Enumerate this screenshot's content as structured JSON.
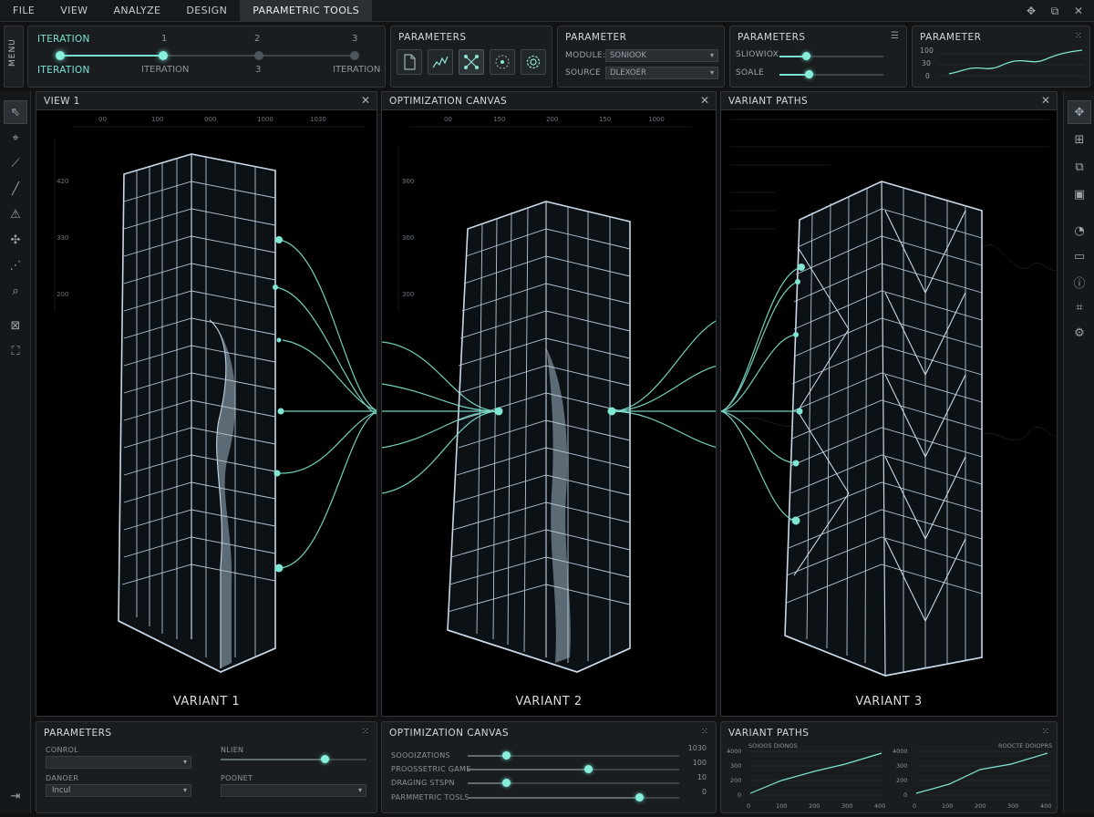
{
  "menu": {
    "items": [
      "FILE",
      "VIEW",
      "ANALYZE",
      "DESIGN",
      "PARAMETRIC TOOLS"
    ],
    "active": "PARAMETRIC TOOLS"
  },
  "side_tab": {
    "label": "MENU"
  },
  "iteration_panel": {
    "top_label": "ITERATION",
    "bottom_left_label": "ITERATION",
    "steps_top": [
      "1",
      "2",
      "3"
    ],
    "steps_bottom": [
      "ITERATION",
      "3",
      "ITERATION"
    ],
    "progress": 0.35
  },
  "tools_panel": {
    "title": "PARAMETERS",
    "tools": [
      "document-icon",
      "graph-icon",
      "nodes-icon",
      "target-icon",
      "gear-icon"
    ]
  },
  "parameter_panel": {
    "title": "PARAMETER",
    "module_label": "MODULE:",
    "module_value": "SONIOOK",
    "source_label": "SOURCE",
    "source_value": "DLEXOER"
  },
  "sliders_panel": {
    "title": "PARAMETERS",
    "sliders": [
      {
        "label": "SLIOWIOX",
        "value": 0.25
      },
      {
        "label": "SOALE",
        "value": 0.12
      }
    ]
  },
  "graph_panel": {
    "title": "PARAMETER",
    "ticks": [
      "100",
      "30",
      "0"
    ]
  },
  "views": [
    {
      "title": "VIEW 1",
      "variant": "VARIANT 1",
      "ruler": [
        "00",
        "100",
        "000",
        "1000",
        "1030"
      ],
      "yticks": [
        "420",
        "330",
        "200"
      ]
    },
    {
      "title": "OPTIMIZATION CANVAS",
      "variant": "VARIANT 2",
      "ruler": [
        "00",
        "150",
        "200",
        "150",
        "1000"
      ],
      "yticks": [
        "300",
        "300",
        "300"
      ]
    },
    {
      "title": "VARIANT PATHS",
      "variant": "VARIANT 3",
      "ruler": [],
      "yticks": []
    }
  ],
  "bottom_params": {
    "title": "PARAMETERS",
    "control_label": "CONROL",
    "control_value": "",
    "danger_label": "DANOER",
    "danger_value": "Incul",
    "nlien_label": "NLIEN",
    "nlien_value": 0.71,
    "poonet_label": "POONET",
    "poonet_value": ""
  },
  "bottom_opt": {
    "title": "OPTIMIZATION CANVAS",
    "rows": [
      {
        "label": "SOOOIZATIONS",
        "value": 0.18,
        "readout": "1030"
      },
      {
        "label": "PROOSSETRIC GAME",
        "value": 0.57,
        "readout": "100"
      },
      {
        "label": "DRAGING STSPN",
        "value": 0.18,
        "readout": "10"
      },
      {
        "label": "PARMMETRIC TOSLS",
        "value": 0.81,
        "readout": "0"
      }
    ]
  },
  "bottom_paths": {
    "title": "VARIANT PATHS",
    "charts": [
      {
        "title": "SOIOOS DIONOS",
        "yticks": [
          "4000",
          "300",
          "200",
          "0"
        ],
        "xticks": [
          "0",
          "100",
          "200",
          "300",
          "400"
        ]
      },
      {
        "title": "ROOCTE DOIOPRS",
        "yticks": [
          "4000",
          "300",
          "200",
          "0"
        ],
        "xticks": [
          "0",
          "100",
          "200",
          "300",
          "400"
        ]
      }
    ]
  },
  "colors": {
    "accent": "#7fe6d3",
    "bg": "#101214",
    "panel": "#1a1d20",
    "structure": "#c9d8e6"
  }
}
